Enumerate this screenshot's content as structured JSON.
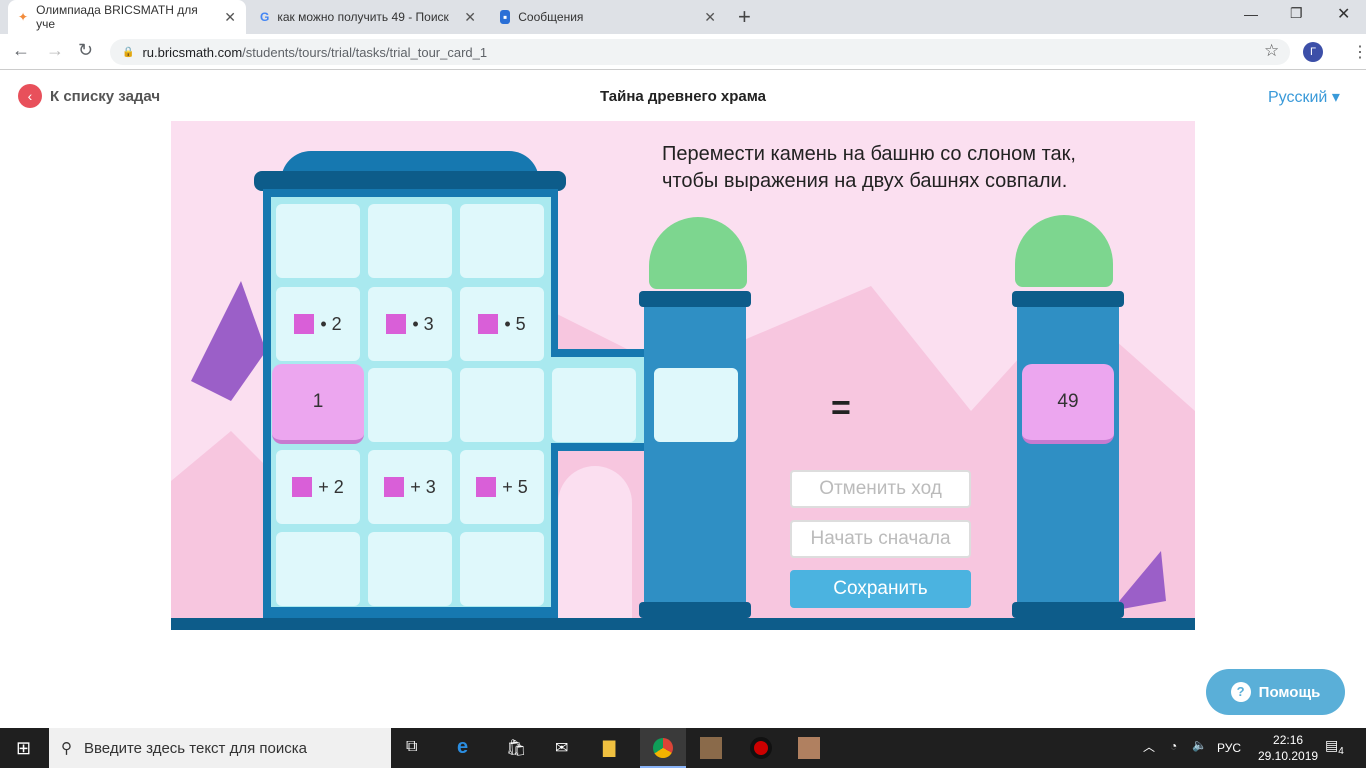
{
  "browser": {
    "tabs": [
      {
        "title": "Олимпиада BRICSMATH для уче",
        "icon": "bricsmath-icon"
      },
      {
        "title": "как можно получить 49 - Поиск",
        "icon": "google-icon"
      },
      {
        "title": "Сообщения",
        "icon": "messages-icon"
      }
    ],
    "url_domain": "ru.bricsmath.com",
    "url_path": "/students/tours/trial/tasks/trial_tour_card_1",
    "profile_initial": "Г"
  },
  "header": {
    "back_label": "К списку задач",
    "title": "Тайна древнего храма",
    "language": "Русский"
  },
  "game": {
    "instruction": "Перемести камень на башню со слоном так, чтобы выражения на двух башнях совпали.",
    "multiply_ops": [
      "• 2",
      "• 3",
      "• 5"
    ],
    "add_ops": [
      "+ 2",
      "+ 3",
      "+ 5"
    ],
    "stone_value": "1",
    "target_value": "49",
    "equals": "=",
    "undo_label": "Отменить ход",
    "restart_label": "Начать сначала",
    "save_label": "Сохранить"
  },
  "help_label": "Помощь",
  "taskbar": {
    "search_placeholder": "Введите здесь текст для поиска",
    "lang": "РУС",
    "time": "22:16",
    "date": "29.10.2019",
    "notifications": "4"
  }
}
